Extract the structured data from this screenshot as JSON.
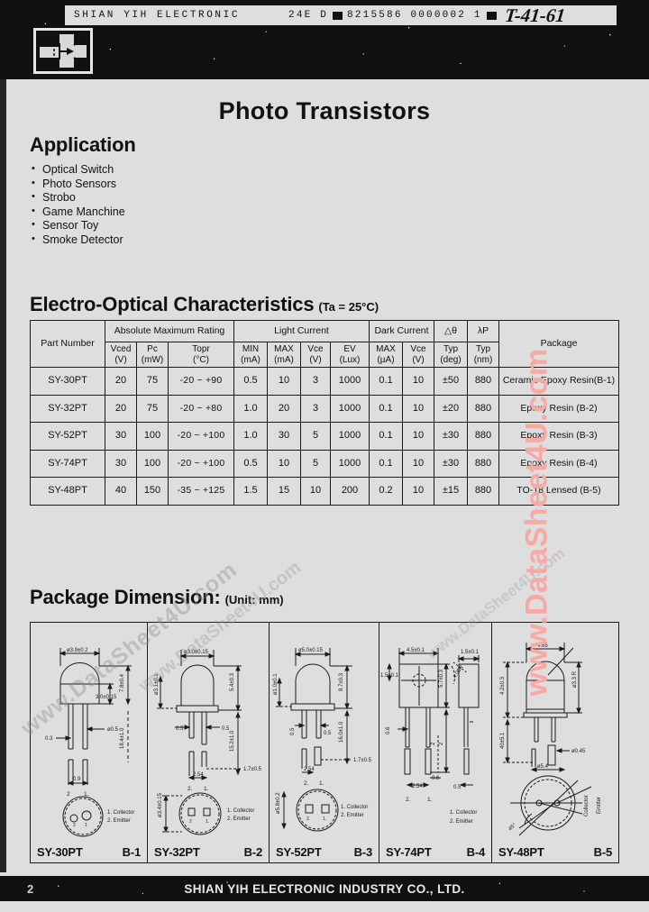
{
  "film_header": {
    "company": "SHIAN YIH ELECTRONIC",
    "code": "24E D",
    "barcode_numbers": "8215586 0000002 1",
    "handwritten": "T-41-61",
    "logo_icon": "phototransistor-symbol-icon"
  },
  "title": "Photo Transistors",
  "application": {
    "heading": "Application",
    "items": [
      "Optical Switch",
      "Photo Sensors",
      "Strobo",
      "Game Manchine",
      "Sensor Toy",
      "Smoke Detector"
    ]
  },
  "characteristics": {
    "heading": "Electro-Optical Characteristics",
    "condition": "(Ta = 25°C)",
    "group_headers": {
      "part_number": "Part Number",
      "absolute_max": "Absolute Maximum Rating",
      "light_current": "Light Current",
      "dark_current": "Dark Current",
      "delta_theta": "△θ",
      "lambda_p": "λP",
      "package": "Package"
    },
    "unit_headers": {
      "vced": "Vced",
      "vced_unit": "(V)",
      "pc": "Pc",
      "pc_unit": "(mW)",
      "topr": "Topr",
      "topr_unit": "(°C)",
      "lc_min": "MIN",
      "lc_min_unit": "(mA)",
      "lc_max": "MAX",
      "lc_max_unit": "(mA)",
      "lc_vce": "Vce",
      "lc_vce_unit": "(V)",
      "ev": "EV",
      "ev_unit": "(Lux)",
      "dc_max": "MAX",
      "dc_max_unit": "(µA)",
      "dc_vce": "Vce",
      "dc_vce_unit": "(V)",
      "dth_typ": "Typ",
      "dth_unit": "(deg)",
      "lp_typ": "Typ",
      "lp_unit": "(nm)"
    },
    "rows": [
      {
        "part": "SY-30PT",
        "vced": "20",
        "pc": "75",
        "topr": "-20 ~  +90",
        "lc_min": "0.5",
        "lc_max": "10",
        "lc_vce": "3",
        "ev": "1000",
        "dc_max": "0.1",
        "dc_vce": "10",
        "dth": "±50",
        "lp": "880",
        "package": "Ceramic Epoxy Resin(B-1)"
      },
      {
        "part": "SY-32PT",
        "vced": "20",
        "pc": "75",
        "topr": "-20 ~  +80",
        "lc_min": "1.0",
        "lc_max": "20",
        "lc_vce": "3",
        "ev": "1000",
        "dc_max": "0.1",
        "dc_vce": "10",
        "dth": "±20",
        "lp": "880",
        "package": "Epoxy Resin (B-2)"
      },
      {
        "part": "SY-52PT",
        "vced": "30",
        "pc": "100",
        "topr": "-20 ~ +100",
        "lc_min": "1.0",
        "lc_max": "30",
        "lc_vce": "5",
        "ev": "1000",
        "dc_max": "0.1",
        "dc_vce": "10",
        "dth": "±30",
        "lp": "880",
        "package": "Epoxy Resin (B-3)"
      },
      {
        "part": "SY-74PT",
        "vced": "30",
        "pc": "100",
        "topr": "-20 ~ +100",
        "lc_min": "0.5",
        "lc_max": "10",
        "lc_vce": "5",
        "ev": "1000",
        "dc_max": "0.1",
        "dc_vce": "10",
        "dth": "±30",
        "lp": "880",
        "package": "Epoxy Resin (B-4)"
      },
      {
        "part": "SY-48PT",
        "vced": "40",
        "pc": "150",
        "topr": "-35 ~ +125",
        "lc_min": "1.5",
        "lc_max": "15",
        "lc_vce": "10",
        "ev": "200",
        "dc_max": "0.2",
        "dc_vce": "10",
        "dth": "±15",
        "lp": "880",
        "package": "TO-18 Lensed (B-5)"
      }
    ]
  },
  "package_dimension": {
    "heading": "Package Dimension:",
    "unit_note": "(Unit: mm)",
    "cells": [
      {
        "part": "SY-30PT",
        "code": "B-1",
        "dims": {
          "width": "ø3.9±0.2",
          "body_h": "3.0±0.15",
          "total_h": "7.8±0.4",
          "lead_len": "18.4±1.0",
          "lead_w": "ø0.5",
          "lead_off": "0.3",
          "pitch": "0.9"
        },
        "pin_legend": [
          "1. Collector",
          "2. Emitter"
        ],
        "pin_numbers": [
          "2",
          "1"
        ]
      },
      {
        "part": "SY-32PT",
        "code": "B-2",
        "dims": {
          "width": "ø3.0±0.15",
          "flange": "ø3.1±0.1",
          "body_h": "5.4±0.3",
          "lead_len": "15.2±1.0",
          "seat": "1.7±0.5",
          "lead_l": "0.5",
          "lead_r": "0.5",
          "pitch": "2.54",
          "base_dia": "ø3.4±0.15"
        },
        "pin_legend": [
          "1. Collector",
          "2. Emitter"
        ],
        "pin_numbers": [
          "2.",
          "1."
        ]
      },
      {
        "part": "SY-52PT",
        "code": "B-3",
        "dims": {
          "width": "ø5.0±0.15",
          "flange": "ø1.0±0.1",
          "body_h": "8.7±0.3",
          "lead_len": "16.0±1.0",
          "seat": "1.7±0.5",
          "lead_l": "0.5",
          "lead_r": "0.5",
          "pitch": "2.54",
          "base_dia": "ø5.8±0.2"
        },
        "pin_legend": [
          "1. Collector",
          "2. Emitter"
        ],
        "pin_numbers": [
          "2.",
          "1."
        ]
      },
      {
        "part": "SY-74PT",
        "code": "B-4",
        "dims": {
          "width": "4.5±0.1",
          "thickness": "1.5±0.1",
          "side_w": "1.5±0.1",
          "radius": "4.05R",
          "body_h": "5.7±0.3",
          "lead_w": "0.6",
          "lead_w2": "0.5",
          "pitch": "2.54"
        },
        "pin_legend": [
          "1. Collector",
          "2. Emitter"
        ],
        "pin_numbers": [
          "2.",
          "1."
        ]
      },
      {
        "part": "SY-48PT",
        "code": "B-5",
        "dims": {
          "width": "4.65",
          "lens_r": "ø3.3 R",
          "body_h": "4.2±0.3",
          "lead_len": "40±5.1",
          "lead_w": "ø0.45",
          "base_dia": "ø5.4",
          "angle": "45°"
        },
        "pin_legend_rotated": [
          "Collector",
          "Emitter"
        ]
      }
    ]
  },
  "footer": {
    "company": "SHIAN YIH ELECTRONIC INDUSTRY CO., LTD.",
    "page_number": "2"
  },
  "watermarks": {
    "right": "www.DataSheet4U.com",
    "diagonal": "www.DataSheet4U.com"
  },
  "colors": {
    "paper": "#dedede",
    "ink": "#111111",
    "watermark_pink": "#f9a9a4"
  }
}
